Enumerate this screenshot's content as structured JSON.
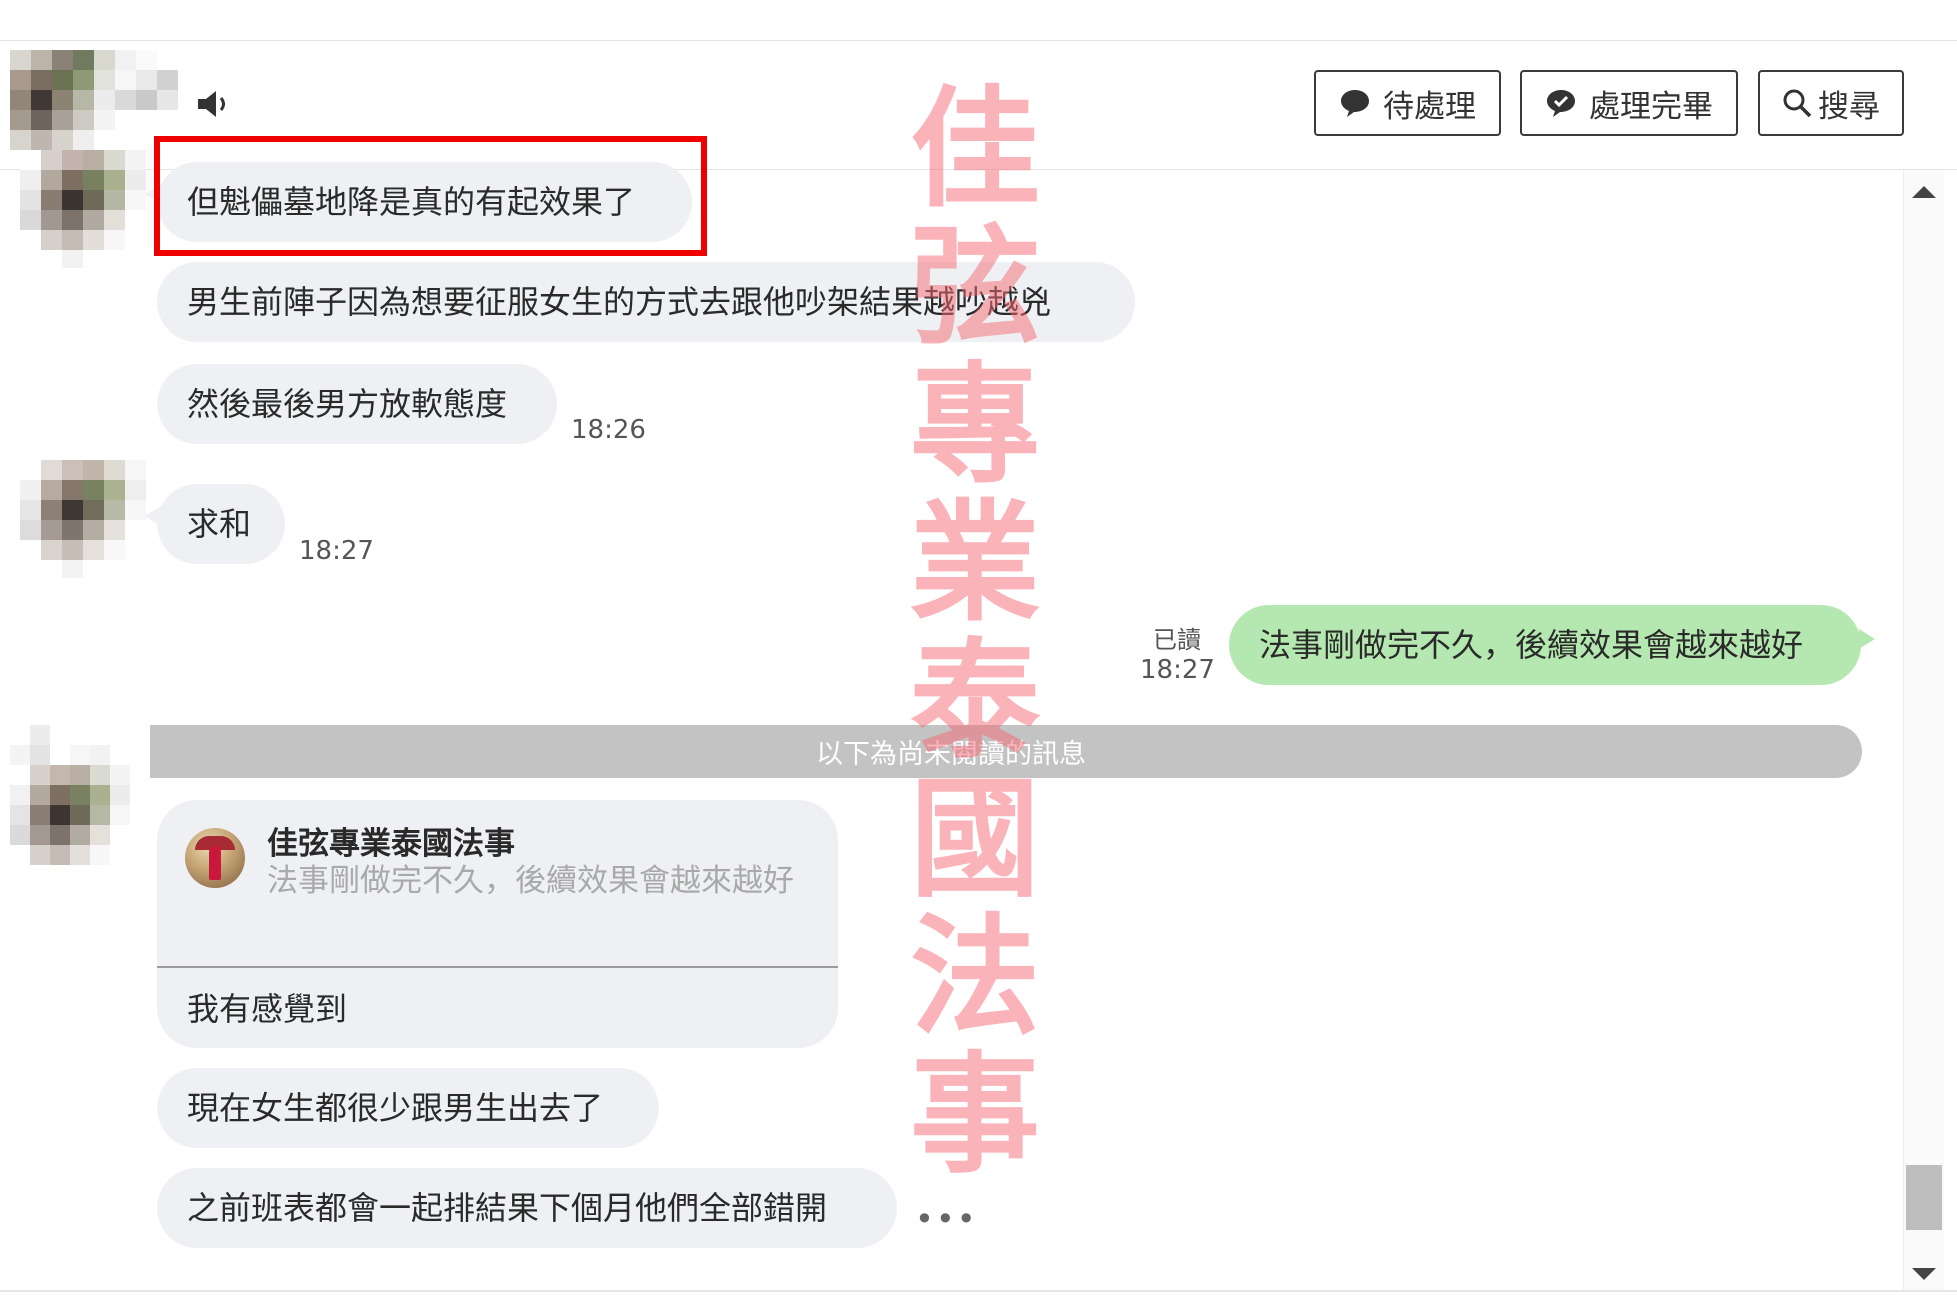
{
  "toolbar": {
    "pending_label": "待處理",
    "done_label": "處理完畢",
    "search_label": "搜尋"
  },
  "messages": {
    "m1": "但魁儡墓地降是真的有起效果了",
    "m2": "男生前陣子因為想要征服女生的方式去跟他吵架結果越吵越兇",
    "m3": "然後最後男方放軟態度",
    "m3_time": "18:26",
    "m4": "求和",
    "m4_time": "18:27",
    "out1": "法事剛做完不久，後續效果會越來越好",
    "out1_read": "已讀",
    "out1_time": "18:27"
  },
  "unread_divider": "以下為尚未閱讀的訊息",
  "reply": {
    "quoted_name": "佳弦專業泰國法事",
    "quoted_text": "法事剛做完不久，後續效果會越來越好",
    "text": "我有感覺到"
  },
  "messages_after": {
    "m5": "現在女生都很少跟男生出去了",
    "m6": "之前班表都會一起排結果下個月他們全部錯開"
  },
  "more_label": "•••",
  "watermark_chars": [
    "佳",
    "弦",
    "專",
    "業",
    "泰",
    "國",
    "法",
    "事"
  ],
  "colors": {
    "incoming_bubble": "#eef0f3",
    "outgoing_bubble": "#b5e8b0",
    "highlight_box": "#ee0000",
    "watermark": "#f56973",
    "unread_bar": "#c3c3c3"
  }
}
